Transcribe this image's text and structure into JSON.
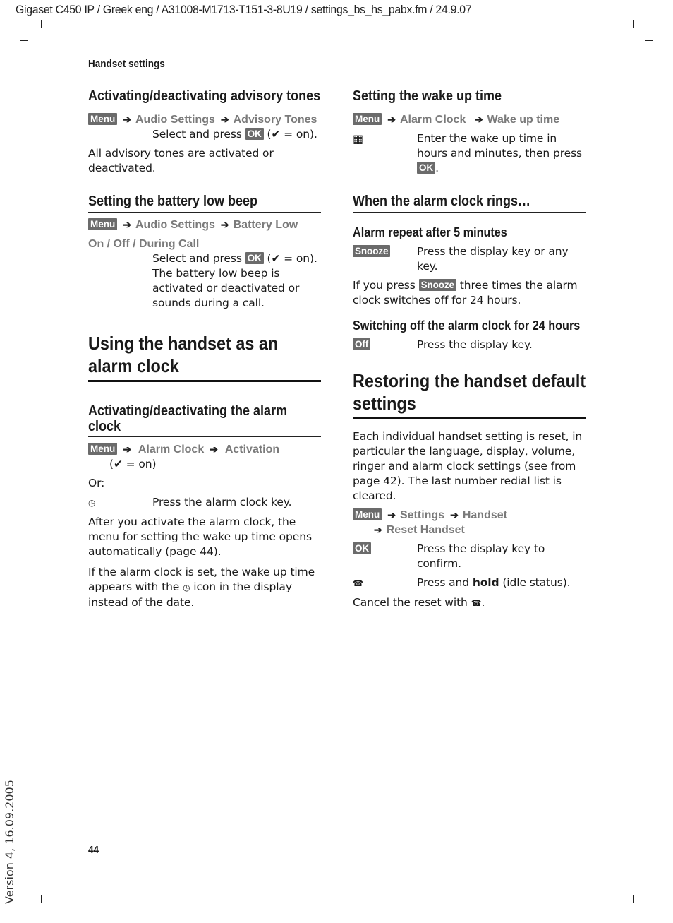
{
  "file_header": "Gigaset C450 IP / Greek eng / A31008-M1713-T151-3-8U19 / settings_bs_hs_pabx.fm / 24.9.07",
  "running_head": "Handset settings",
  "keys": {
    "menu": "Menu",
    "ok": "OK",
    "snooze": "Snooze",
    "off": "Off"
  },
  "symbols": {
    "arrow": "➔",
    "check": "✔",
    "alarm_clock_icon": "◷",
    "keypad_icon": "▦",
    "end_call_icon": "☎"
  },
  "left": {
    "advisory": {
      "title": "Activating/deactivating advisory tones",
      "path": [
        "Audio Settings",
        "Advisory Tones"
      ],
      "instruction_pre": "Select and press",
      "instruction_post": "( ",
      "on_suffix": " = on).",
      "body": "All advisory tones are activated or deactivated."
    },
    "battery": {
      "title": "Setting the battery low beep",
      "path": [
        "Audio Settings",
        "Battery Low"
      ],
      "options": "On / Off / During Call",
      "instruction_pre": "Select and press",
      "on_suffix": " = on).",
      "body": "The battery low beep is activated or deactivated or sounds during a call."
    },
    "alarm_clock": {
      "title": "Using the handset as an alarm clock",
      "title_line1": "Using the handset as an",
      "title_line2": "alarm clock",
      "activate": {
        "title_line1": "Activating/deactivating the alarm",
        "title_line2": "clock",
        "path": [
          "Alarm Clock",
          "Activation"
        ],
        "on_note": " = on)",
        "or": "Or:",
        "key_action": "Press the alarm clock key.",
        "para1": "After you activate the alarm clock, the menu for setting the wake up time opens automatically (page 44).",
        "para2_pre": "If the alarm clock is set, the wake up time appears with the",
        "para2_post": "icon in the display instead of the date."
      }
    }
  },
  "right": {
    "wake_up": {
      "title": "Setting the wake up time",
      "path": [
        "Alarm Clock",
        "Wake up time"
      ],
      "instruction": "Enter the wake up time in hours and minutes, then press",
      "instruction_end": "."
    },
    "rings": {
      "title": "When the alarm clock rings…",
      "repeat_title": "Alarm repeat after 5 minutes",
      "repeat_action": "Press the display key or any key.",
      "repeat_note_pre": "If you press",
      "repeat_note_post": "three times the alarm clock switches off for 24 hours.",
      "off_title": "Switching off the alarm clock for 24 hours",
      "off_action": "Press the display key."
    },
    "restore": {
      "title_line1": "Restoring the handset default",
      "title_line2": "settings",
      "body": "Each individual handset setting is reset, in particular the language, display, volume, ringer and alarm clock settings (see from page 42). The last number redial list is cleared.",
      "path": [
        "Settings",
        "Handset",
        "Reset Handset"
      ],
      "ok_action": "Press the display key to confirm.",
      "hold_pre": "Press and ",
      "hold_bold": "hold",
      "hold_post": " (idle status).",
      "cancel_pre": "Cancel the reset with",
      "cancel_post": "."
    }
  },
  "page_number": "44",
  "version": "Version 4, 16.09.2005"
}
